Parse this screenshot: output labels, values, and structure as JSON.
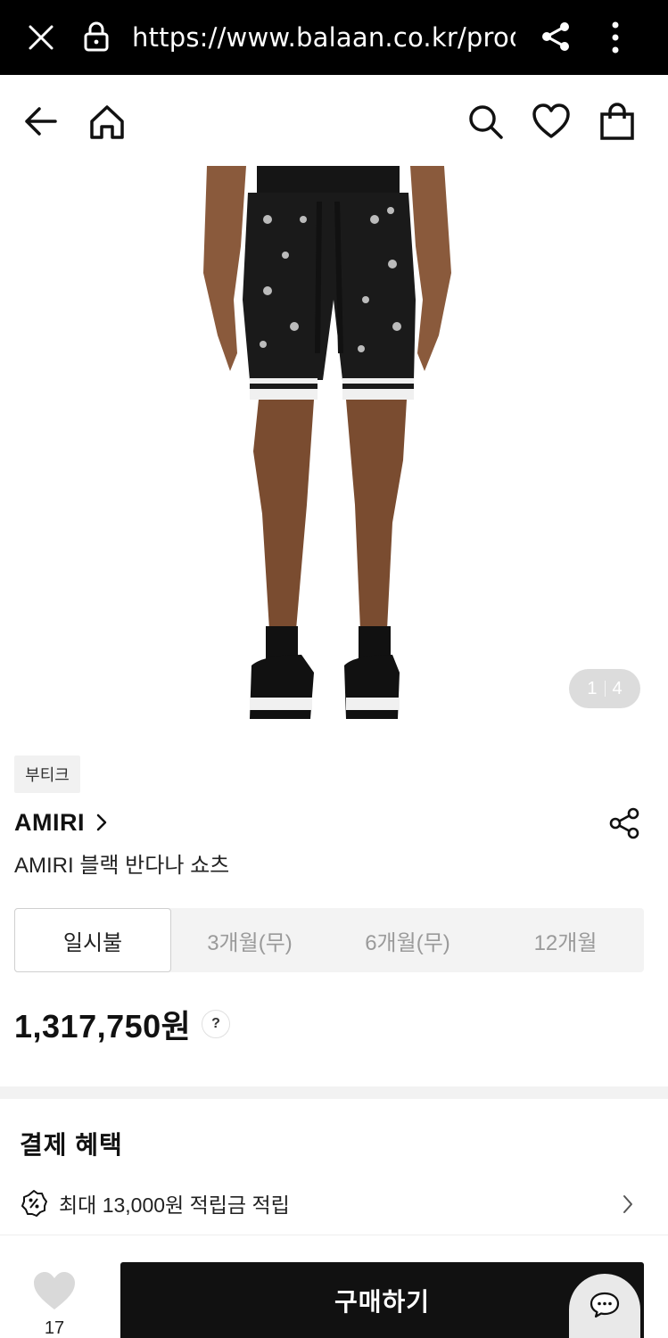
{
  "browser": {
    "url": "https://www.balaan.co.kr/produc"
  },
  "gallery": {
    "current": "1",
    "total": "4"
  },
  "product": {
    "tag": "부티크",
    "brand": "AMIRI",
    "name": "AMIRI 블랙 반다나 쇼츠",
    "price": "1,317,750원",
    "help": "?"
  },
  "installments": {
    "tabs": [
      "일시불",
      "3개월(무)",
      "6개월(무)",
      "12개월"
    ],
    "selected_index": 0
  },
  "benefits": {
    "title": "결제 혜택",
    "items": [
      "최대 13,000원 적립금 적립"
    ]
  },
  "bottom_bar": {
    "like_count": "17",
    "buy_label": "구매하기"
  },
  "icons": {
    "chrome": [
      "close-icon",
      "lock-icon",
      "share-icon",
      "more-icon"
    ],
    "appbar": [
      "back-arrow-icon",
      "home-icon",
      "search-icon",
      "heart-icon",
      "shopping-bag-icon"
    ],
    "product": [
      "chevron-right-icon",
      "share-icon"
    ],
    "benefits": [
      "percent-badge-icon",
      "chevron-right-icon"
    ],
    "bottom": [
      "heart-icon",
      "chat-icon"
    ]
  },
  "colors": {
    "chrome_bg": "#000000",
    "buy_button": "#111111",
    "tabs_bg": "#f3f3f3",
    "pager_bg": "#dcdcdc"
  }
}
